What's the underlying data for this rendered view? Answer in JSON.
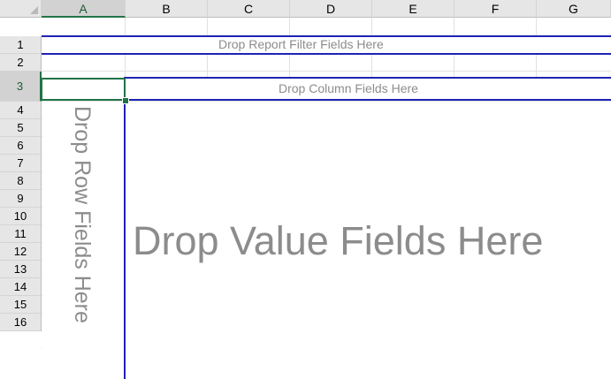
{
  "columns": [
    "A",
    "B",
    "C",
    "D",
    "E",
    "F",
    "G"
  ],
  "rows": [
    "1",
    "2",
    "3",
    "4",
    "5",
    "6",
    "7",
    "8",
    "9",
    "10",
    "11",
    "12",
    "13",
    "14",
    "15",
    "16"
  ],
  "selected_cell": {
    "column": "A",
    "row": "3"
  },
  "pivot": {
    "report_filter_label": "Drop Report Filter Fields Here",
    "column_fields_label": "Drop Column Fields Here",
    "row_fields_label": "Drop Row Fields Here",
    "value_fields_label": "Drop Value Fields Here"
  },
  "colors": {
    "pivot_border": "#1f23b4",
    "selection": "#217346",
    "placeholder_text": "#8c8c8c"
  }
}
